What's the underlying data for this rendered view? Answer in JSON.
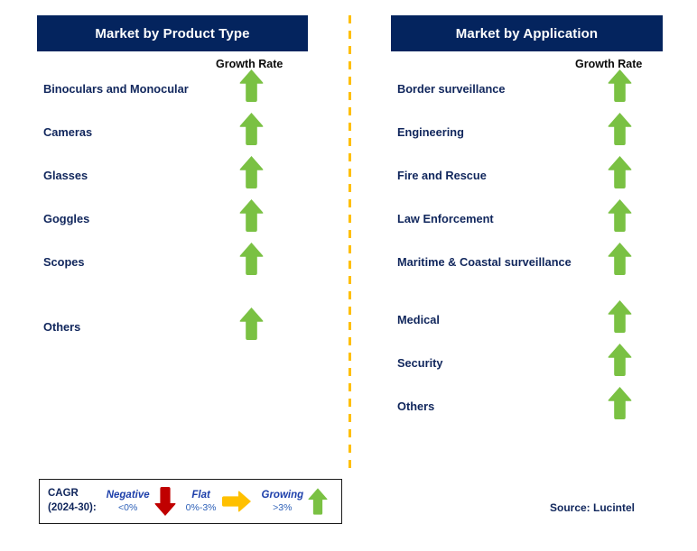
{
  "colors": {
    "header_navy": "#04245e",
    "label_navy": "#10265c",
    "arrow_green": "#7ac143",
    "arrow_red": "#c00000",
    "arrow_amber": "#ffc000",
    "divider_amber": "#ffbf00",
    "legend_term_blue": "#1d3faa"
  },
  "columns": {
    "left": {
      "title": "Market by Product Type",
      "growth_rate_label": "Growth Rate",
      "rows": [
        {
          "label": "Binoculars and Monocular",
          "growth": "growing",
          "icon": "arrow-up-icon"
        },
        {
          "label": "Cameras",
          "growth": "growing",
          "icon": "arrow-up-icon"
        },
        {
          "label": "Glasses",
          "growth": "growing",
          "icon": "arrow-up-icon"
        },
        {
          "label": "Goggles",
          "growth": "growing",
          "icon": "arrow-up-icon"
        },
        {
          "label": "Scopes",
          "growth": "growing",
          "icon": "arrow-up-icon"
        },
        {
          "label": "Others",
          "growth": "growing",
          "icon": "arrow-up-icon"
        }
      ]
    },
    "right": {
      "title": "Market by Application",
      "growth_rate_label": "Growth Rate",
      "rows": [
        {
          "label": "Border surveillance",
          "growth": "growing",
          "icon": "arrow-up-icon"
        },
        {
          "label": "Engineering",
          "growth": "growing",
          "icon": "arrow-up-icon"
        },
        {
          "label": "Fire and Rescue",
          "growth": "growing",
          "icon": "arrow-up-icon"
        },
        {
          "label": "Law Enforcement",
          "growth": "growing",
          "icon": "arrow-up-icon"
        },
        {
          "label": "Maritime & Coastal surveillance",
          "growth": "growing",
          "icon": "arrow-up-icon"
        },
        {
          "label": "Medical",
          "growth": "growing",
          "icon": "arrow-up-icon"
        },
        {
          "label": "Security",
          "growth": "growing",
          "icon": "arrow-up-icon"
        },
        {
          "label": "Others",
          "growth": "growing",
          "icon": "arrow-up-icon"
        }
      ]
    }
  },
  "legend": {
    "title_line1": "CAGR",
    "title_line2": "(2024-30):",
    "items": [
      {
        "term": "Negative",
        "range": "<0%",
        "icon": "arrow-down-icon",
        "color": "#c00000"
      },
      {
        "term": "Flat",
        "range": "0%-3%",
        "icon": "arrow-right-icon",
        "color": "#ffc000"
      },
      {
        "term": "Growing",
        "range": ">3%",
        "icon": "arrow-up-icon",
        "color": "#7ac143"
      }
    ]
  },
  "source": "Source: Lucintel"
}
